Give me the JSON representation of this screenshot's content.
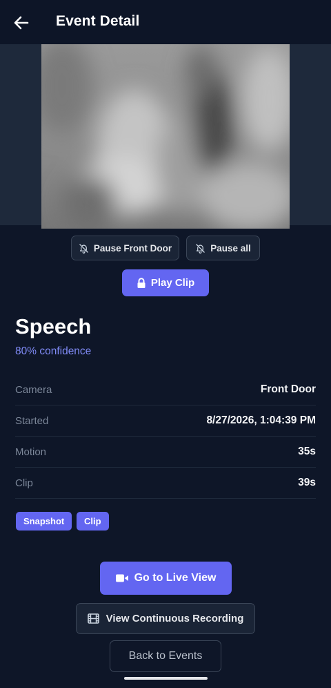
{
  "header": {
    "title": "Event Detail",
    "back_icon": "arrow-left-icon"
  },
  "media": {
    "snapshot_icon": "blurred-snapshot-image",
    "pause_camera_label": "Pause Front Door",
    "pause_all_label": "Pause all",
    "pause_icon": "bell-off-icon",
    "play_clip_label": "Play Clip",
    "play_clip_icon": "lock-icon"
  },
  "event": {
    "name": "Speech",
    "confidence": "80% confidence"
  },
  "details": [
    {
      "label": "Camera",
      "value": "Front Door"
    },
    {
      "label": "Started",
      "value": "8/27/2026, 1:04:39 PM"
    },
    {
      "label": "Motion",
      "value": "35s"
    },
    {
      "label": "Clip",
      "value": "39s"
    }
  ],
  "tags": [
    "Snapshot",
    "Clip"
  ],
  "actions": {
    "live_view_label": "Go to Live View",
    "live_view_icon": "video-camera-icon",
    "continuous_label": "View Continuous Recording",
    "continuous_icon": "film-icon",
    "back_label": "Back to Events"
  },
  "colors": {
    "background": "#0e1628",
    "accent": "#6366f1",
    "confidence_text": "#818cf8",
    "media_band": "#1e293b"
  }
}
